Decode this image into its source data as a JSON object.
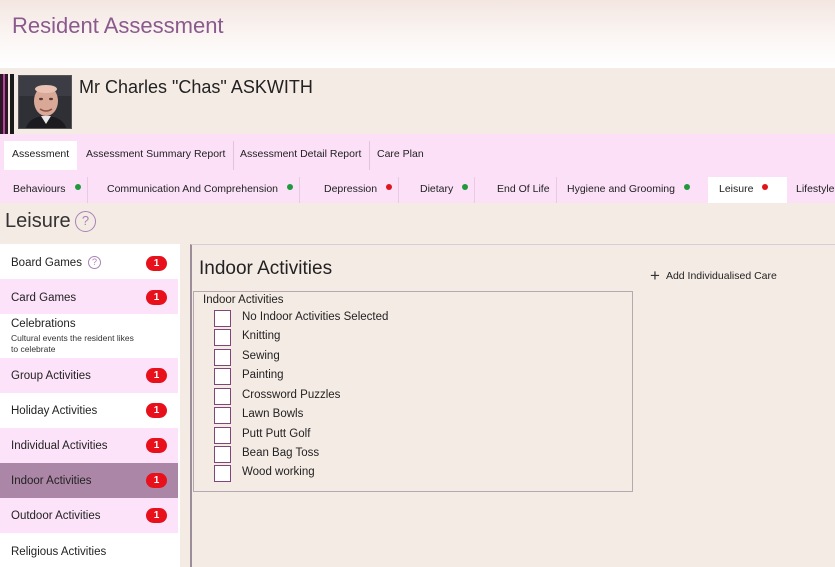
{
  "app": {
    "title": "Resident Assessment"
  },
  "resident": {
    "name": "Mr Charles \"Chas\" ASKWITH"
  },
  "main_tabs": [
    {
      "label": "Assessment"
    },
    {
      "label": "Assessment Summary Report"
    },
    {
      "label": "Assessment Detail Report"
    },
    {
      "label": "Care Plan"
    }
  ],
  "sub_tabs": [
    {
      "label": "Behaviours",
      "status": "green"
    },
    {
      "label": "Communication And Comprehension",
      "status": "green"
    },
    {
      "label": "Depression",
      "status": "red"
    },
    {
      "label": "Dietary",
      "status": "green"
    },
    {
      "label": "End Of Life"
    },
    {
      "label": "Hygiene and Grooming",
      "status": "green"
    },
    {
      "label": "Leisure",
      "status": "red"
    },
    {
      "label": "Lifestyle"
    }
  ],
  "section": {
    "title": "Leisure",
    "help_icon": "?"
  },
  "categories": [
    {
      "label": "Board Games",
      "badge": "1",
      "help": "?"
    },
    {
      "label": "Card Games",
      "badge": "1"
    },
    {
      "label": "Celebrations",
      "description": "Cultural events the resident likes to celebrate"
    },
    {
      "label": "Group Activities",
      "badge": "1"
    },
    {
      "label": "Holiday Activities",
      "badge": "1"
    },
    {
      "label": "Individual Activities",
      "badge": "1"
    },
    {
      "label": "Indoor Activities",
      "badge": "1"
    },
    {
      "label": "Outdoor Activities",
      "badge": "1"
    },
    {
      "label": "Religious Activities"
    }
  ],
  "main": {
    "title": "Indoor Activities",
    "add_button": "Add Individualised Care",
    "group_label": "Indoor Activities",
    "options": [
      "No Indoor Activities Selected",
      "Knitting",
      "Sewing",
      "Painting",
      "Crossword Puzzles",
      "Lawn Bowls",
      "Putt Putt Golf",
      "Bean Bag Toss",
      "Wood working"
    ]
  },
  "colors": {
    "accent": "#8a5a8c",
    "tab_bar": "#fbe0f8",
    "selected_item": "#ac86a7",
    "badge": "#e8101a",
    "status_green": "#1e9a3c",
    "status_red": "#e0151a"
  }
}
